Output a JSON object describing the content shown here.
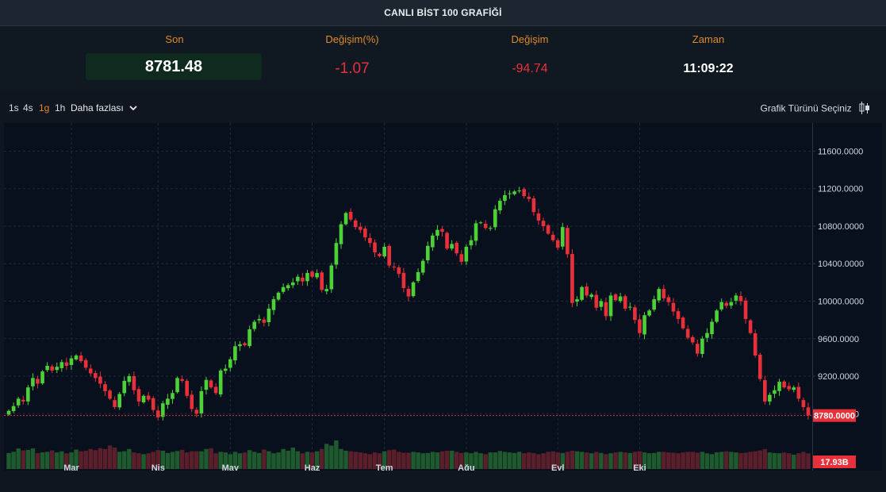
{
  "header": {
    "title": "CANLI BİST 100 GRAFİĞİ"
  },
  "stats": {
    "son": {
      "label": "Son",
      "value": "8781.48"
    },
    "change_pct": {
      "label": "Değişim(%)",
      "value": "-1.07"
    },
    "change": {
      "label": "Değişim",
      "value": "-94.74"
    },
    "time": {
      "label": "Zaman",
      "value": "11:09:22"
    }
  },
  "toolbar": {
    "timeframes": [
      "1s",
      "4s",
      "1g",
      "1h"
    ],
    "active_timeframe": "1g",
    "more_label": "Daha fazlası",
    "chart_type_label": "Grafik Türünü Seçiniz",
    "icons": [
      "chevron-down-icon",
      "candlestick-icon"
    ]
  },
  "colors": {
    "up": "#4cd137",
    "down": "#e8303a",
    "accent": "#e08a2c",
    "price_tag": "#e8303a"
  },
  "chart_data": {
    "type": "candlestick",
    "y_ticks": [
      "11600.0000",
      "11200.0000",
      "10800.0000",
      "10400.0000",
      "10000.0000",
      "9600.0000",
      "9200.0000",
      "8800.0000"
    ],
    "y_ticks_values": [
      11600,
      11200,
      10800,
      10400,
      10000,
      9600,
      9200,
      8800
    ],
    "ylim": [
      8650,
      11900
    ],
    "x_labels": [
      "Mar",
      "Nis",
      "May",
      "Haz",
      "Tem",
      "Ağu",
      "Eyl",
      "Eki"
    ],
    "x_label_positions": [
      13,
      31,
      46,
      63,
      78,
      95,
      114,
      131
    ],
    "last_price_label": "8780.0000",
    "last_price": 8780,
    "volume_label": "17.93B",
    "closes": [
      8830,
      8880,
      8960,
      8930,
      9080,
      9180,
      9120,
      9250,
      9310,
      9260,
      9300,
      9350,
      9310,
      9390,
      9420,
      9360,
      9290,
      9230,
      9180,
      9120,
      9040,
      8960,
      8870,
      9010,
      9150,
      9200,
      9050,
      8930,
      8990,
      8950,
      8840,
      8760,
      8910,
      8960,
      9020,
      9180,
      9150,
      8990,
      8850,
      8800,
      9040,
      9160,
      9080,
      9020,
      9260,
      9280,
      9380,
      9520,
      9540,
      9530,
      9700,
      9780,
      9810,
      9770,
      9920,
      10020,
      10090,
      10150,
      10170,
      10200,
      10260,
      10210,
      10300,
      10260,
      10300,
      10120,
      10130,
      10380,
      10620,
      10820,
      10940,
      10870,
      10790,
      10760,
      10680,
      10620,
      10520,
      10480,
      10580,
      10380,
      10360,
      10290,
      10140,
      10050,
      10200,
      10310,
      10430,
      10590,
      10700,
      10760,
      10740,
      10560,
      10610,
      10510,
      10420,
      10580,
      10650,
      10830,
      10840,
      10780,
      10780,
      10980,
      11070,
      11130,
      11150,
      11170,
      11180,
      11120,
      11090,
      10950,
      10860,
      10800,
      10720,
      10650,
      10570,
      10790,
      10500,
      9980,
      10020,
      10150,
      10060,
      10070,
      9930,
      10000,
      9840,
      10060,
      10010,
      10050,
      9920,
      9940,
      9800,
      9660,
      9850,
      9900,
      10020,
      10130,
      10030,
      9990,
      9890,
      9810,
      9710,
      9610,
      9560,
      9440,
      9600,
      9660,
      9780,
      9900,
      9990,
      9950,
      9990,
      10060,
      10000,
      9810,
      9660,
      9420,
      9170,
      8930,
      9000,
      9050,
      9140,
      9080,
      9060,
      9080,
      8960,
      8870,
      8781.48
    ],
    "volumes": [
      0.56,
      0.6,
      0.72,
      0.65,
      0.67,
      0.72,
      0.56,
      0.58,
      0.6,
      0.65,
      0.58,
      0.62,
      0.55,
      0.58,
      0.68,
      0.62,
      0.64,
      0.7,
      0.66,
      0.73,
      0.7,
      0.82,
      0.75,
      0.6,
      0.62,
      0.7,
      0.58,
      0.55,
      0.52,
      0.55,
      0.6,
      0.66,
      0.64,
      0.56,
      0.6,
      0.63,
      0.67,
      0.58,
      0.62,
      0.62,
      0.62,
      0.7,
      0.73,
      0.55,
      0.6,
      0.58,
      0.52,
      0.6,
      0.55,
      0.58,
      0.66,
      0.6,
      0.56,
      0.68,
      0.62,
      0.55,
      0.58,
      0.7,
      0.64,
      0.75,
      0.62,
      0.55,
      0.6,
      0.58,
      0.62,
      0.7,
      0.88,
      0.82,
      1.0,
      0.7,
      0.64,
      0.62,
      0.6,
      0.58,
      0.55,
      0.52,
      0.58,
      0.55,
      0.62,
      0.66,
      0.68,
      0.6,
      0.57,
      0.57,
      0.6,
      0.58,
      0.55,
      0.56,
      0.6,
      0.58,
      0.62,
      0.64,
      0.64,
      0.6,
      0.56,
      0.58,
      0.55,
      0.6,
      0.55,
      0.52,
      0.58,
      0.58,
      0.63,
      0.6,
      0.58,
      0.56,
      0.6,
      0.55,
      0.58,
      0.56,
      0.52,
      0.55,
      0.6,
      0.62,
      0.58,
      0.56,
      0.6,
      0.64,
      0.62,
      0.6,
      0.58,
      0.55,
      0.6,
      0.56,
      0.52,
      0.55,
      0.58,
      0.6,
      0.58,
      0.56,
      0.6,
      0.62,
      0.58,
      0.55,
      0.56,
      0.6,
      0.6,
      0.58,
      0.57,
      0.55,
      0.58,
      0.6,
      0.6,
      0.57,
      0.6,
      0.55,
      0.52,
      0.58,
      0.6,
      0.62,
      0.6,
      0.58,
      0.56,
      0.57,
      0.6,
      0.62,
      0.65,
      0.7,
      0.58,
      0.56,
      0.55,
      0.58,
      0.55,
      0.5,
      0.55,
      0.6,
      0.55
    ]
  }
}
